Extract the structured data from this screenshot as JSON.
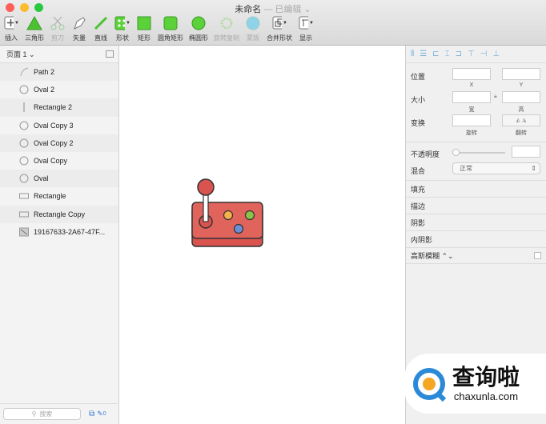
{
  "window": {
    "title": "未命名",
    "status": "— 已编辑 ⌄"
  },
  "toolbar": {
    "tools": [
      {
        "label": "插入",
        "icon": "plus-icon"
      },
      {
        "label": "三角形",
        "icon": "triangle-icon"
      },
      {
        "label": "剪刀",
        "icon": "scissors-icon",
        "disabled": true
      },
      {
        "label": "矢量",
        "icon": "pen-icon"
      },
      {
        "label": "直线",
        "icon": "line-icon"
      },
      {
        "label": "形状",
        "icon": "shapes-icon"
      },
      {
        "label": "矩形",
        "icon": "rectangle-icon"
      },
      {
        "label": "圆角矩形",
        "icon": "rounded-rectangle-icon"
      },
      {
        "label": "椭圆形",
        "icon": "oval-icon"
      },
      {
        "label": "旋转复制",
        "icon": "rotate-copy-icon",
        "disabled": true
      },
      {
        "label": "蒙版",
        "icon": "mask-icon",
        "disabled": true
      },
      {
        "label": "合并形状",
        "icon": "combine-icon"
      },
      {
        "label": "显示",
        "icon": "view-icon"
      }
    ]
  },
  "layers": {
    "page": "页面 1 ⌄",
    "items": [
      {
        "name": "Path 2",
        "icon": "path-icon"
      },
      {
        "name": "Oval 2",
        "icon": "oval-icon"
      },
      {
        "name": "Rectangle 2",
        "icon": "thin-rect-icon"
      },
      {
        "name": "Oval Copy 3",
        "icon": "oval-icon"
      },
      {
        "name": "Oval Copy 2",
        "icon": "oval-icon"
      },
      {
        "name": "Oval Copy",
        "icon": "oval-icon"
      },
      {
        "name": "Oval",
        "icon": "oval-icon"
      },
      {
        "name": "Rectangle",
        "icon": "rect-icon"
      },
      {
        "name": "Rectangle Copy",
        "icon": "rect-icon"
      },
      {
        "name": "19167633-2A67-47F...",
        "icon": "image-icon"
      }
    ],
    "search_placeholder": "搜索",
    "count": "0"
  },
  "inspector": {
    "position": "位置",
    "x": "X",
    "y": "Y",
    "size": "大小",
    "w": "宽",
    "h": "高",
    "transform": "变换",
    "rotate": "旋转",
    "flip": "翻转",
    "opacity": "不透明度",
    "opacity_value": 0,
    "blend": "混合",
    "blend_value": "正常",
    "sections": [
      "填充",
      "描边",
      "阴影",
      "内阴影"
    ],
    "blur": "高斯模糊 ⌃⌄"
  },
  "colors": {
    "accent": "#5bd13a",
    "body": "#d9534f",
    "orange": "#f7b14a",
    "green": "#8bc34a",
    "blue": "#6b8fd6"
  },
  "watermark": {
    "logo": "查询啦",
    "url": "chaxunla.com"
  }
}
